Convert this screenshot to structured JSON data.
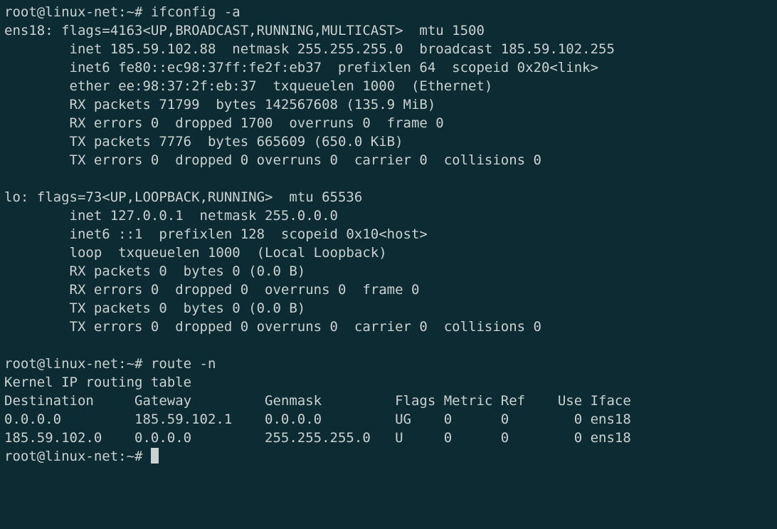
{
  "prompts": {
    "p1": "root@linux-net:~# ",
    "p2": "root@linux-net:~# ",
    "p3": "root@linux-net:~# "
  },
  "commands": {
    "c1": "ifconfig -a",
    "c2": "route -n"
  },
  "ifconfig": {
    "l01": "ens18: flags=4163<UP,BROADCAST,RUNNING,MULTICAST>  mtu 1500",
    "l02": "        inet 185.59.102.88  netmask 255.255.255.0  broadcast 185.59.102.255",
    "l03": "        inet6 fe80::ec98:37ff:fe2f:eb37  prefixlen 64  scopeid 0x20<link>",
    "l04": "        ether ee:98:37:2f:eb:37  txqueuelen 1000  (Ethernet)",
    "l05": "        RX packets 71799  bytes 142567608 (135.9 MiB)",
    "l06": "        RX errors 0  dropped 1700  overruns 0  frame 0",
    "l07": "        TX packets 7776  bytes 665609 (650.0 KiB)",
    "l08": "        TX errors 0  dropped 0 overruns 0  carrier 0  collisions 0",
    "l09": "",
    "l10": "lo: flags=73<UP,LOOPBACK,RUNNING>  mtu 65536",
    "l11": "        inet 127.0.0.1  netmask 255.0.0.0",
    "l12": "        inet6 ::1  prefixlen 128  scopeid 0x10<host>",
    "l13": "        loop  txqueuelen 1000  (Local Loopback)",
    "l14": "        RX packets 0  bytes 0 (0.0 B)",
    "l15": "        RX errors 0  dropped 0  overruns 0  frame 0",
    "l16": "        TX packets 0  bytes 0 (0.0 B)",
    "l17": "        TX errors 0  dropped 0 overruns 0  carrier 0  collisions 0",
    "l18": ""
  },
  "route": {
    "title": "Kernel IP routing table",
    "hdr": "Destination     Gateway         Genmask         Flags Metric Ref    Use Iface",
    "r1": "0.0.0.0         185.59.102.1    0.0.0.0         UG    0      0        0 ens18",
    "r2": "185.59.102.0    0.0.0.0         255.255.255.0   U     0      0        0 ens18"
  }
}
